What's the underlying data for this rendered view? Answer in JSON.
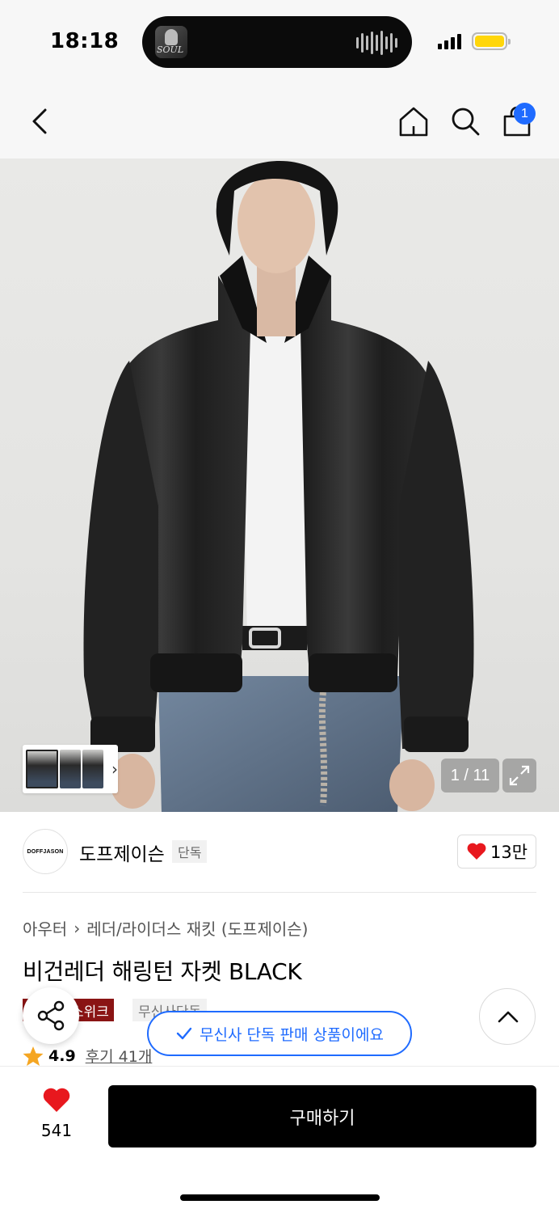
{
  "status_bar": {
    "time": "18:18",
    "island_art_text": "SOUL",
    "battery_color": "#ffd60a"
  },
  "header": {
    "back_icon": "chevron-left-icon",
    "home_icon": "home-icon",
    "search_icon": "search-icon",
    "cart_icon": "shopping-bag-icon",
    "cart_badge": "1",
    "badge_color": "#1f6bff"
  },
  "gallery": {
    "counter": "1 / 11",
    "expand_icon": "expand-icon"
  },
  "brand": {
    "logo_text": "DOFFJASON",
    "name": "도프제이슨",
    "exclusive_tag": "단독",
    "likes": "13만"
  },
  "product": {
    "breadcrumb": [
      "아우터",
      "레더/라이더스 재킷 (도프제이슨)"
    ],
    "title": "비건레더 해링턴 자켓 BLACK",
    "tag_red": "스위크",
    "tag_grey": "무신사단독",
    "rating": "4.9",
    "reviews": "후기 41개"
  },
  "toast": {
    "text": "무신사 단독 판매 상품이에요",
    "color": "#1f6bff"
  },
  "bottom_bar": {
    "like_count": "541",
    "buy_label": "구매하기"
  }
}
